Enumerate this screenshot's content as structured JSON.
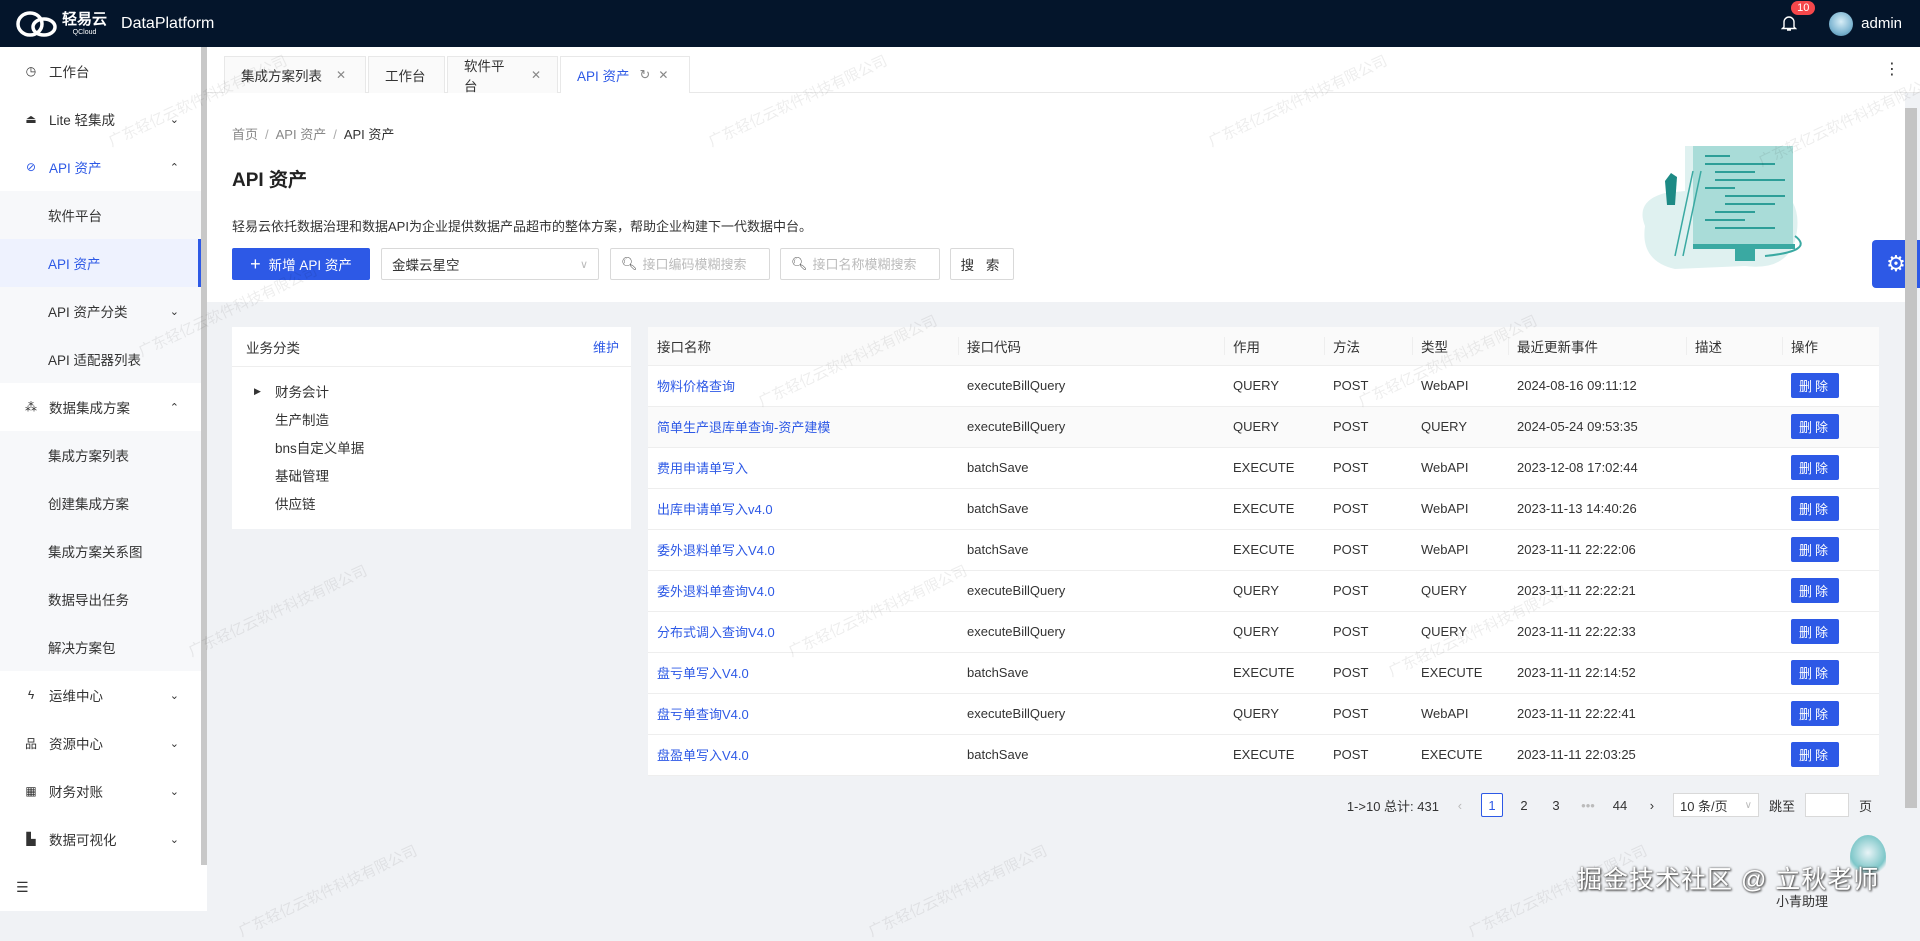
{
  "header": {
    "logo_cn": "轻易云",
    "logo_en": "QCloud",
    "app_title": "DataPlatform",
    "notifications": "10",
    "user": "admin"
  },
  "sidebar": {
    "items": [
      {
        "label": "工作台",
        "icon": "clock-icon",
        "level": "top",
        "chevron": ""
      },
      {
        "label": "Lite 轻集成",
        "icon": "robot-icon",
        "level": "top",
        "chevron": "down"
      },
      {
        "label": "API 资产",
        "icon": "compass-icon",
        "level": "top",
        "chevron": "up",
        "state": "active-parent"
      },
      {
        "label": "软件平台",
        "level": "sub"
      },
      {
        "label": "API 资产",
        "level": "sub",
        "state": "active"
      },
      {
        "label": "API 资产分类",
        "level": "sub",
        "chevron": "down"
      },
      {
        "label": "API 适配器列表",
        "level": "sub"
      },
      {
        "label": "数据集成方案",
        "icon": "network-icon",
        "level": "top",
        "chevron": "up"
      },
      {
        "label": "集成方案列表",
        "level": "sub"
      },
      {
        "label": "创建集成方案",
        "level": "sub"
      },
      {
        "label": "集成方案关系图",
        "level": "sub"
      },
      {
        "label": "数据导出任务",
        "level": "sub"
      },
      {
        "label": "解决方案包",
        "level": "sub"
      },
      {
        "label": "运维中心",
        "icon": "lightning-icon",
        "level": "top",
        "chevron": "down"
      },
      {
        "label": "资源中心",
        "icon": "sitemap-icon",
        "level": "top",
        "chevron": "down"
      },
      {
        "label": "财务对账",
        "icon": "calculator-icon",
        "level": "top",
        "chevron": "down"
      },
      {
        "label": "数据可视化",
        "icon": "area-chart-icon",
        "level": "top",
        "chevron": "down"
      }
    ]
  },
  "tabs": [
    {
      "label": "集成方案列表",
      "closable": true
    },
    {
      "label": "工作台",
      "closable": false
    },
    {
      "label": "软件平台",
      "closable": true
    },
    {
      "label": "API 资产",
      "closable": true,
      "active": true
    }
  ],
  "page": {
    "breadcrumb": [
      "首页",
      "API 资产",
      "API 资产"
    ],
    "title": "API 资产",
    "description": "轻易云依托数据治理和数据API为企业提供数据产品超市的整体方案，帮助企业构建下一代数据中台。",
    "add_button": "新增 API 资产",
    "platform_select": "金蝶云星空",
    "code_search_placeholder": "接口编码模糊搜索",
    "name_search_placeholder": "接口名称模糊搜索",
    "search_button": "搜 索"
  },
  "category": {
    "title": "业务分类",
    "action": "维护",
    "nodes": [
      "财务会计",
      "生产制造",
      "bns自定义单据",
      "基础管理",
      "供应链"
    ]
  },
  "table": {
    "columns": [
      "接口名称",
      "接口代码",
      "作用",
      "方法",
      "类型",
      "最近更新事件",
      "描述",
      "操作"
    ],
    "delete_label": "删除",
    "rows": [
      [
        "物料价格查询",
        "executeBillQuery",
        "QUERY",
        "POST",
        "WebAPI",
        "2024-08-16 09:11:12",
        ""
      ],
      [
        "简单生产退库单查询-资产建模",
        "executeBillQuery",
        "QUERY",
        "POST",
        "QUERY",
        "2024-05-24 09:53:35",
        ""
      ],
      [
        "费用申请单写入",
        "batchSave",
        "EXECUTE",
        "POST",
        "WebAPI",
        "2023-12-08 17:02:44",
        ""
      ],
      [
        "出库申请单写入v4.0",
        "batchSave",
        "EXECUTE",
        "POST",
        "WebAPI",
        "2023-11-13 14:40:26",
        ""
      ],
      [
        "委外退料单写入V4.0",
        "batchSave",
        "EXECUTE",
        "POST",
        "WebAPI",
        "2023-11-11 22:22:06",
        ""
      ],
      [
        "委外退料单查询V4.0",
        "executeBillQuery",
        "QUERY",
        "POST",
        "QUERY",
        "2023-11-11 22:22:21",
        ""
      ],
      [
        "分布式调入查询V4.0",
        "executeBillQuery",
        "QUERY",
        "POST",
        "QUERY",
        "2023-11-11 22:22:33",
        ""
      ],
      [
        "盘亏单写入V4.0",
        "batchSave",
        "EXECUTE",
        "POST",
        "EXECUTE",
        "2023-11-11 22:14:52",
        ""
      ],
      [
        "盘亏单查询V4.0",
        "executeBillQuery",
        "QUERY",
        "POST",
        "WebAPI",
        "2023-11-11 22:22:41",
        ""
      ],
      [
        "盘盈单写入V4.0",
        "batchSave",
        "EXECUTE",
        "POST",
        "EXECUTE",
        "2023-11-11 22:03:25",
        ""
      ]
    ]
  },
  "pagination": {
    "summary": "1->10 总计: 431",
    "pages": [
      "1",
      "2",
      "3",
      "•••",
      "44"
    ],
    "current": "1",
    "page_size": "10 条/页",
    "jump_label": "跳至",
    "page_unit": "页"
  },
  "watermark": "广东轻亿云软件科技有限公司",
  "overlay": {
    "community": "掘金技术社区 @ 立秋老师",
    "assistant": "小青助理"
  },
  "colors": {
    "primary": "#2d59e6",
    "topbar": "#04152b",
    "badge": "#f5474b"
  }
}
